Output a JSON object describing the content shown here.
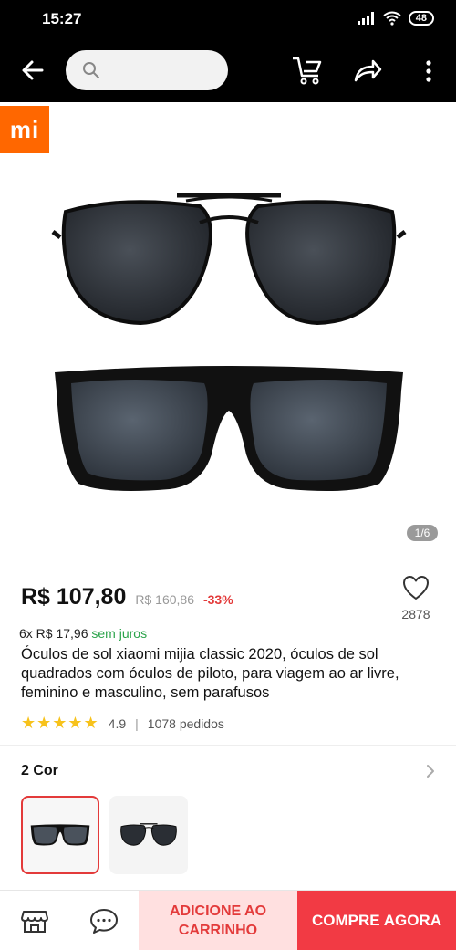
{
  "status_bar": {
    "time": "15:27",
    "battery": "48"
  },
  "search": {
    "placeholder": ""
  },
  "brand": {
    "logo_text": "mi"
  },
  "gallery": {
    "counter": "1/6"
  },
  "product": {
    "price": "R$ 107,80",
    "old_price": "R$ 160,86",
    "discount": "-33%",
    "installment_prefix": "6x R$ 17,96",
    "installment_suffix": "sem juros",
    "title": "Óculos de sol xiaomi mijia classic 2020, óculos de sol quadrados com óculos de piloto, para viagem ao ar livre, feminino e masculino, sem parafusos",
    "rating_stars": "★★★★★",
    "rating": "4.9",
    "orders": "1078 pedidos",
    "wish_count": "2878"
  },
  "variants": {
    "title": "2 Cor",
    "selected_index": 0
  },
  "bottom_bar": {
    "add_to_cart": "ADICIONE AO CARRINHO",
    "buy_now": "COMPRE AGORA"
  },
  "colors": {
    "accent_red": "#f23a44",
    "add_cart_bg": "#ffe0e0",
    "brand_orange": "#ff6700",
    "installment_green": "#2aa34a",
    "star_yellow": "#f7c21b"
  },
  "icons": [
    "back-arrow-icon",
    "search-icon",
    "cart-icon",
    "share-icon",
    "more-vertical-icon",
    "heart-icon",
    "chevron-right-icon",
    "store-icon",
    "chat-icon"
  ]
}
